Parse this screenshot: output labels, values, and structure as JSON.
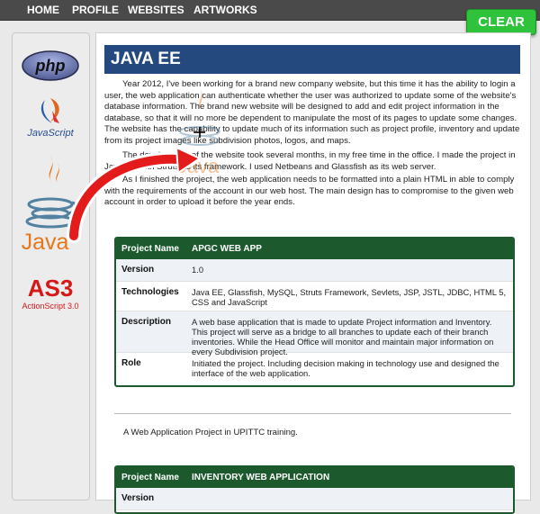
{
  "nav": {
    "home": "HOME",
    "profile": "PROFILE",
    "websites": "WEBSITES",
    "artworks": "ARTWORKS"
  },
  "clear_label": "CLEAR",
  "sidebar": {
    "php": "php",
    "javascript": "JavaScript",
    "java": "Java",
    "as3": "AS3",
    "as3_sub": "ActionScript 3.0"
  },
  "page": {
    "title": "JAVA EE",
    "para1": "Year 2012, I've been working for a brand new company website, but this time it has the ability to login a user, the web application can authenticate whether the user was authorized to update some of the website's database information. The brand new website will be designed to add and edit project information in the database, so that it will no more be dependent to manipulate the most of its pages to update some changes. The website has the capability to update much of its information such as project profile, inventory and update from its project images like subdivision photos, logos, and maps.",
    "para2": "The development of the website took several months, in my free time in the office. I made the project in Java EE with Struts as its framework. I used Netbeans and Glassfish as its web server.",
    "para3": "As I finished the project, the web application needs to be formatted into a plain HTML in able to comply with the requirements of the account in our web host. The main design has to compromise to the given web account in order to upload it before the year ends.",
    "project1": {
      "head_key": "Project Name",
      "head_val": "APGC WEB APP",
      "rows": [
        {
          "k": "Version",
          "v": "1.0"
        },
        {
          "k": "Technologies",
          "v": "Java EE, Glassfish, MySQL, Struts Framework, Sevlets, JSP, JSTL, JDBC, HTML 5, CSS and JavaScript"
        },
        {
          "k": "Description",
          "v": "A web base application that is made to update Project information and Inventory. This project will serve as a bridge to all branches to update each of their branch inventories. While the Head Office will monitor and maintain major information on every Subdivision project."
        },
        {
          "k": "Role",
          "v": "Initiated the project. Including decision making in technology use and designed the interface of the web application."
        }
      ]
    },
    "caption": "A Web Application Project in UPITTC training.",
    "project2": {
      "head_key": "Project Name",
      "head_val": "INVENTORY WEB APPLICATION",
      "row_k": "Version"
    }
  },
  "colors": {
    "nav_bg": "#4a4a4a",
    "accent_green": "#2ec33a",
    "title_blue": "#24497f",
    "card_green": "#1c5a2e",
    "java_orange": "#e8761b",
    "java_blue": "#5382a1"
  }
}
